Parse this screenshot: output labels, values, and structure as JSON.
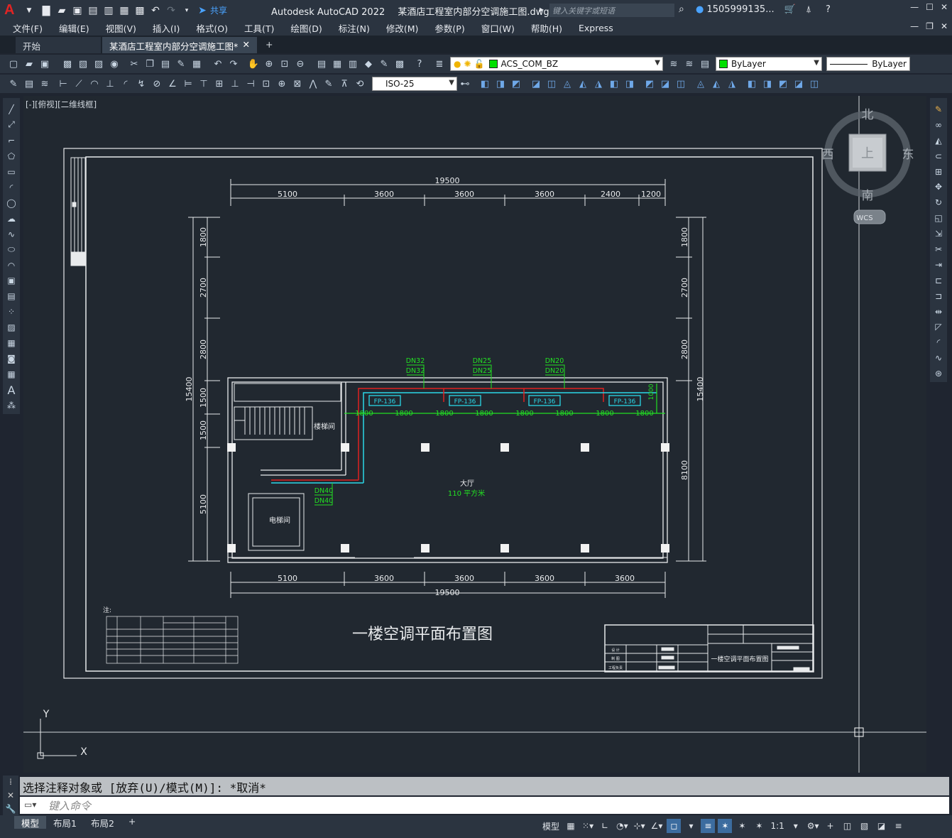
{
  "titlebar": {
    "app_title": "Autodesk AutoCAD 2022",
    "document_name": "某酒店工程室内部分空调施工图.dwg",
    "search_placeholder": "键入关键字或短语",
    "user_name": "1505999135...",
    "share_label": "共享"
  },
  "menubar": {
    "items": [
      "文件(F)",
      "编辑(E)",
      "视图(V)",
      "插入(I)",
      "格式(O)",
      "工具(T)",
      "绘图(D)",
      "标注(N)",
      "修改(M)",
      "参数(P)",
      "窗口(W)",
      "帮助(H)",
      "Express"
    ]
  },
  "tabs": [
    {
      "label": "开始"
    },
    {
      "label": "某酒店工程室内部分空调施工图*"
    }
  ],
  "toolbar": {
    "layer_name": "ACS_COM_BZ",
    "color_value": "ByLayer",
    "linetype_value": "ByLayer",
    "dimstyle_value": "ISO-25",
    "layer_color": "#00e000"
  },
  "viewport": {
    "view_label": "[-][俯视][二维线框]"
  },
  "viewcube": {
    "north": "北",
    "south": "南",
    "east": "东",
    "west": "西",
    "face": "上",
    "wcs": "WCS"
  },
  "drawing": {
    "title": "一楼空调平面布置图",
    "top_total": "19500",
    "top_dims": [
      "5100",
      "3600",
      "3600",
      "3600",
      "2400",
      "1200"
    ],
    "bottom_dims": [
      "5100",
      "3600",
      "3600",
      "3600",
      "3600"
    ],
    "bottom_total": "19500",
    "left_total": "15400",
    "left_dims": [
      "1800",
      "2700",
      "2800",
      "1500",
      "1500",
      "5100"
    ],
    "right_total": "15400",
    "right_dims": [
      "1800",
      "2700",
      "2800",
      "8100"
    ],
    "pipe_labels": [
      "DN32",
      "DN32",
      "DN25",
      "DN25",
      "DN20",
      "DN20",
      "DN40",
      "DN40"
    ],
    "unit_label": "FP-136",
    "spacing_label": "1800",
    "vertical_note": "1000",
    "room_stair": "楼梯间",
    "room_elevator": "电梯间",
    "room_hall": "大厅",
    "room_area": "110 平方米",
    "note_label": "注:",
    "axis_y": "Y",
    "axis_x": "X",
    "titleblock_main": "一楼空调平面布置图",
    "titleblock_rows": [
      "设 计",
      "制 图",
      "工程负责"
    ]
  },
  "command": {
    "history": "选择注释对象或 [放弃(U)/模式(M)]: *取消*",
    "input_placeholder": "键入命令"
  },
  "statusbar": {
    "layout_tabs": [
      "模型",
      "布局1",
      "布局2"
    ],
    "model_label": "模型",
    "scale": "1:1"
  }
}
